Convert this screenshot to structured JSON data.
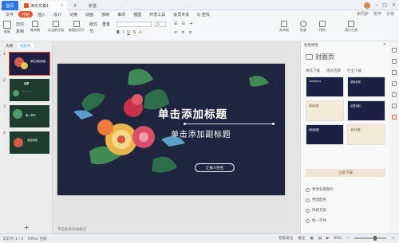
{
  "titlebar": {
    "home_tab": "首页",
    "doc_tab": "演示文稿1",
    "new_tab_symbol": "+",
    "extra_tab": "新建"
  },
  "menubar": {
    "items": [
      "文件",
      "开始",
      "插入",
      "设计",
      "切换",
      "动画",
      "放映",
      "审阅",
      "视图",
      "开发工具",
      "会员专享",
      "Q 查找"
    ],
    "active_index": 1,
    "right_items": [
      "未同步",
      "协作",
      "分享"
    ]
  },
  "toolbar": {
    "paste": "粘贴",
    "cut": "剪切",
    "copy": "复制",
    "format_painter": "格式刷",
    "start_from": "从当前开始",
    "new_slide": "新建幻灯片",
    "layout": "版式",
    "section": "节",
    "reset": "重置",
    "text_box": "文本框",
    "shape": "形状",
    "arrange": "排列",
    "smart_art": "演示工具",
    "font_size": "0",
    "bold": "B",
    "italic": "I",
    "underline": "U"
  },
  "left_panel": {
    "tabs": [
      "大纲",
      "幻灯片"
    ],
    "slides": [
      {
        "num": "1",
        "title": "单击添加标题"
      },
      {
        "num": "2",
        "title": "目录"
      },
      {
        "num": "3",
        "title": "第一章节"
      },
      {
        "num": "4",
        "title": "添加标题"
      }
    ],
    "add_symbol": "+"
  },
  "slide": {
    "title": "单击添加标题",
    "subtitle": "单击添加副标题",
    "presenter": "汇报人姓名",
    "notes_placeholder": "单击此处添加备注"
  },
  "right_panel": {
    "header": "智能特性",
    "title": "封面页",
    "filters": [
      "精选下载",
      "版式选择",
      "行业下载"
    ],
    "cards": [
      "Company",
      "蒙版色调",
      "添加标题",
      "这里添加",
      "添加标题",
      "添加标题"
    ],
    "more_button": "立即下载",
    "links": [
      "更改背景图片",
      "更改配色",
      "风格方案",
      "统一字体"
    ]
  },
  "statusbar": {
    "slide_info": "幻灯片 1 / 4",
    "theme": "Office 主题",
    "smart": "智能美化",
    "notes": "备注",
    "zoom": "66%"
  },
  "colors": {
    "accent": "#e8532c",
    "blue": "#2b78e4",
    "slide_bg": "#20253f"
  }
}
